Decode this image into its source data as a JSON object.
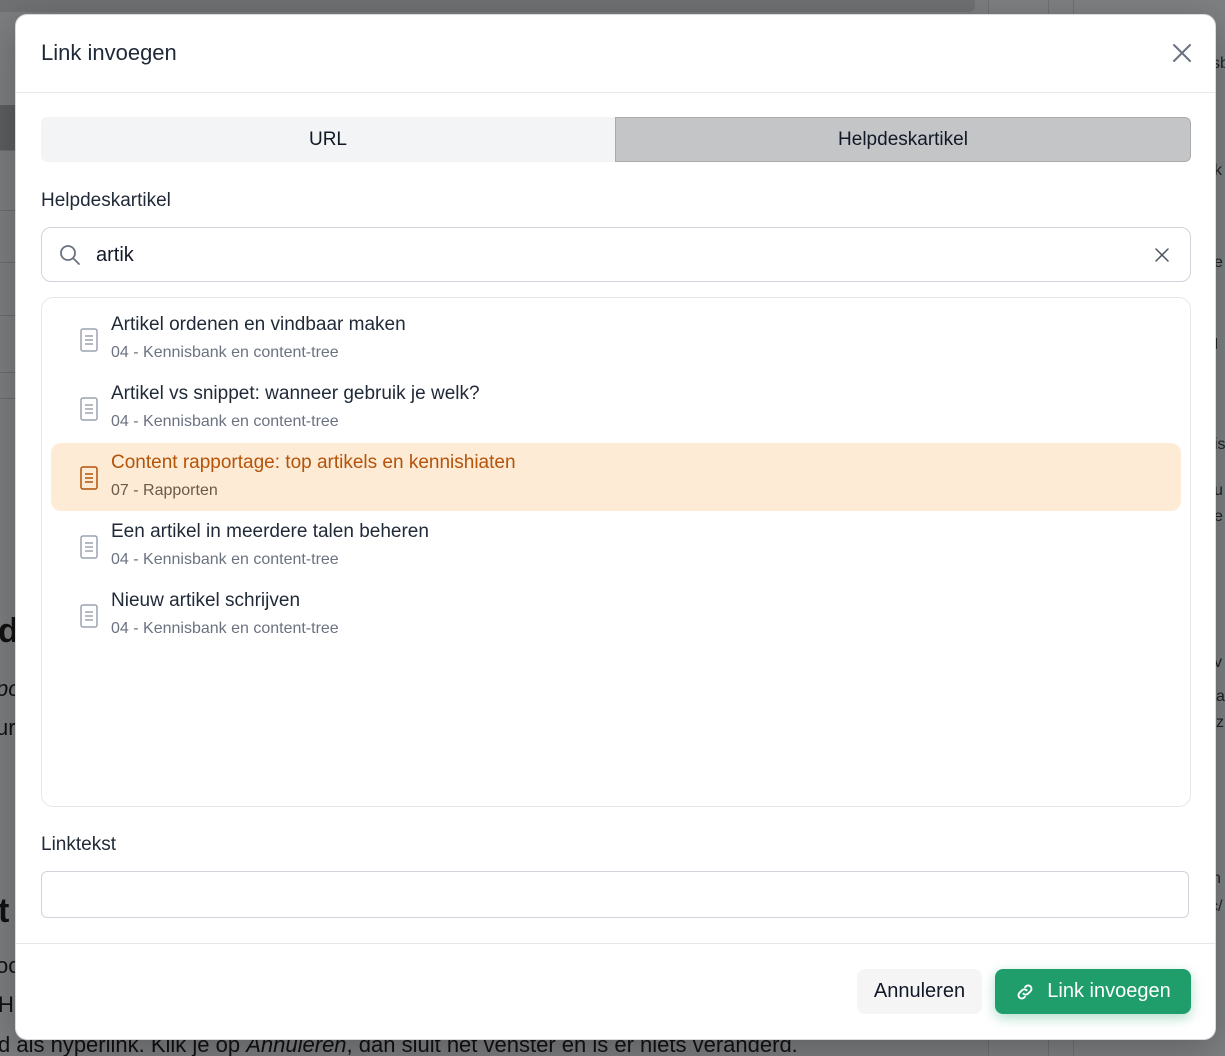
{
  "modal": {
    "title": "Link invoegen",
    "tabs": [
      {
        "label": "URL",
        "active": false
      },
      {
        "label": "Helpdeskartikel",
        "active": true
      }
    ],
    "article_label": "Helpdeskartikel",
    "search": {
      "value": "artik",
      "icon": "search-icon"
    },
    "results": [
      {
        "title": "Artikel ordenen en vindbaar maken",
        "category": "04 - Kennisbank en content-tree",
        "highlighted": false
      },
      {
        "title": "Artikel vs snippet: wanneer gebruik je welk?",
        "category": "04 - Kennisbank en content-tree",
        "highlighted": false
      },
      {
        "title": "Content rapportage: top artikels en kennishiaten",
        "category": "07 - Rapporten",
        "highlighted": true
      },
      {
        "title": "Een artikel in meerdere talen beheren",
        "category": "04 - Kennisbank en content-tree",
        "highlighted": false
      },
      {
        "title": "Nieuw artikel schrijven",
        "category": "04 - Kennisbank en content-tree",
        "highlighted": false
      }
    ],
    "linktext_label": "Linktekst",
    "linktext_value": "",
    "footer": {
      "cancel_label": "Annuleren",
      "insert_label": "Link invoegen"
    }
  },
  "background": {
    "bottom_text": "d als hyperlink. Klik je op ",
    "bottom_italic": "Annuleren",
    "bottom_text_2": ", dan sluit het venster en is er niets veranderd.",
    "fragments": [
      "d",
      "t",
      "po",
      "ur",
      "oc",
      "H",
      "sb",
      "k",
      "is",
      "u",
      "e",
      "v",
      "a",
      "z",
      "n",
      "c/",
      "I",
      "e"
    ]
  },
  "colors": {
    "accent": "#1f9d6b",
    "highlight_bg": "#fdebd6",
    "highlight_text": "#b45309",
    "active_tab": "#c4c5c7"
  }
}
